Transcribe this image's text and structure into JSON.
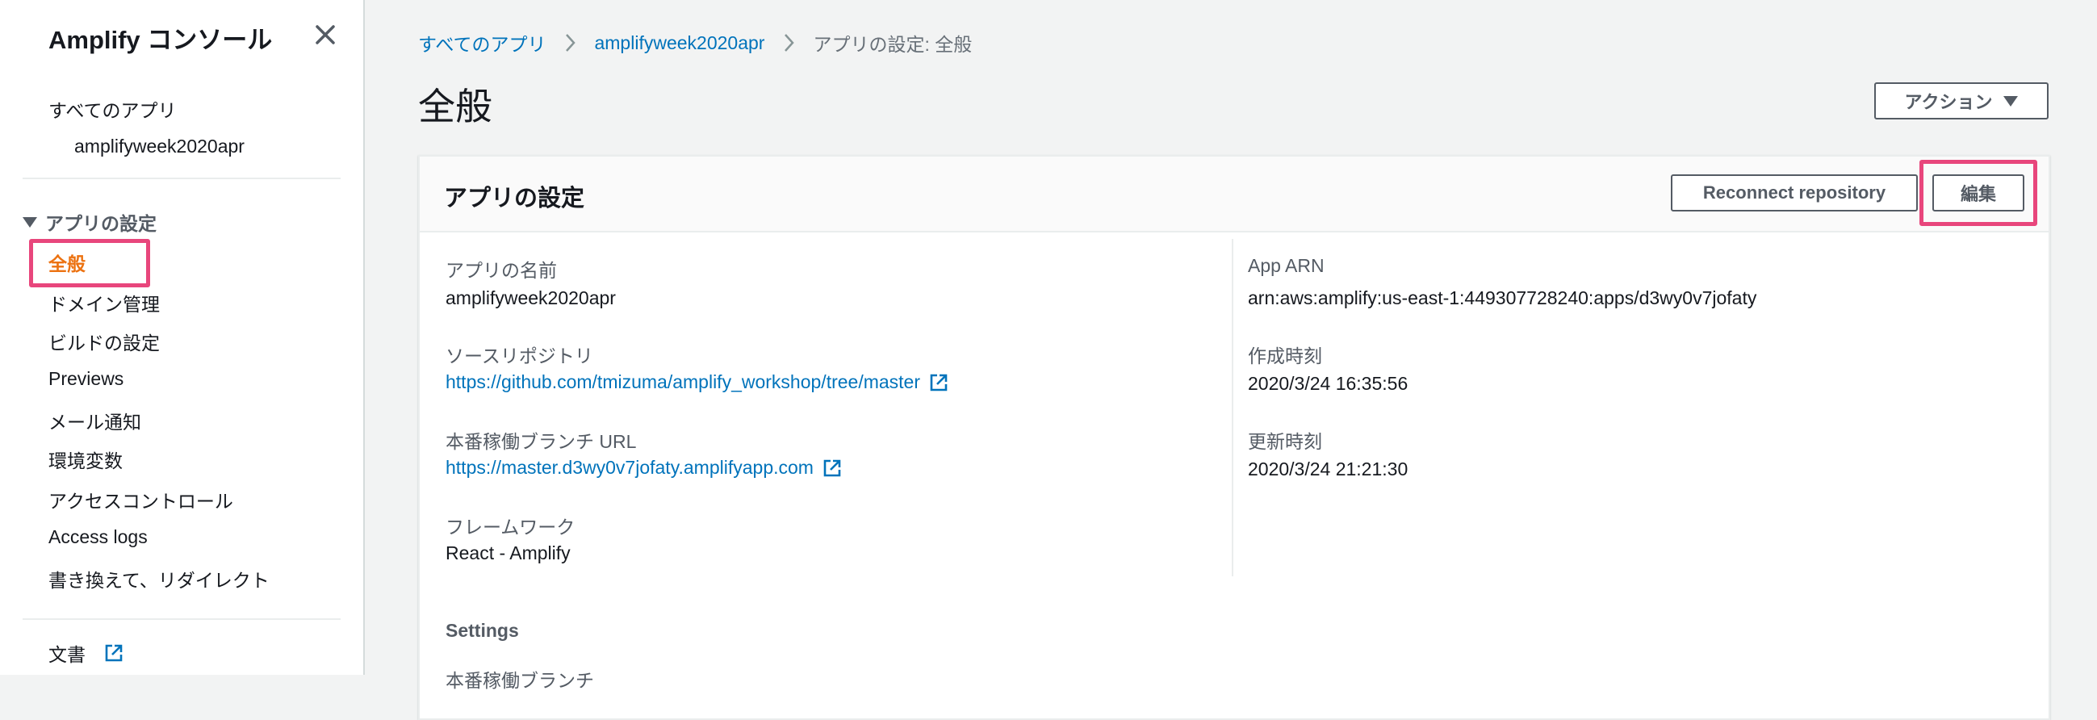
{
  "sidebar": {
    "title": "Amplify コンソール",
    "all_apps": "すべてのアプリ",
    "app_name": "amplifyweek2020apr",
    "section_label": "アプリの設定",
    "items": [
      {
        "label": "全般"
      },
      {
        "label": "ドメイン管理"
      },
      {
        "label": "ビルドの設定"
      },
      {
        "label": "Previews"
      },
      {
        "label": "メール通知"
      },
      {
        "label": "環境変数"
      },
      {
        "label": "アクセスコントロール"
      },
      {
        "label": "Access logs"
      },
      {
        "label": "書き換えて、リダイレクト"
      }
    ],
    "docs_label": "文書"
  },
  "breadcrumb": {
    "items": [
      "すべてのアプリ",
      "amplifyweek2020apr"
    ],
    "current": "アプリの設定: 全般"
  },
  "page": {
    "title": "全般",
    "action_label": "アクション"
  },
  "panel": {
    "title": "アプリの設定",
    "reconnect_label": "Reconnect repository",
    "edit_label": "編集",
    "fields": {
      "app_name_label": "アプリの名前",
      "app_name_value": "amplifyweek2020apr",
      "repo_label": "ソースリポジトリ",
      "repo_value": "https://github.com/tmizuma/amplify_workshop/tree/master",
      "prod_url_label": "本番稼働ブランチ URL",
      "prod_url_value": "https://master.d3wy0v7jofaty.amplifyapp.com",
      "framework_label": "フレームワーク",
      "framework_value": "React - Amplify",
      "arn_label": "App ARN",
      "arn_value": "arn:aws:amplify:us-east-1:449307728240:apps/d3wy0v7jofaty",
      "created_label": "作成時刻",
      "created_value": "2020/3/24 16:35:56",
      "updated_label": "更新時刻",
      "updated_value": "2020/3/24 21:21:30"
    },
    "settings_heading": "Settings",
    "settings_first_label": "本番稼働ブランチ"
  },
  "colors": {
    "highlight": "#e8467c",
    "active_nav": "#ec7211",
    "link": "#0073bb"
  }
}
